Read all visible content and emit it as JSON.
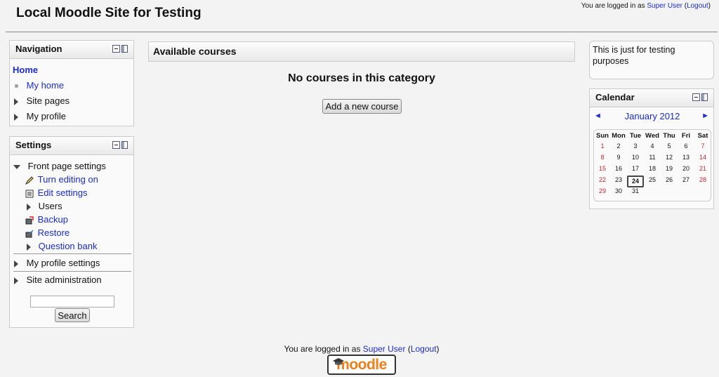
{
  "header": {
    "site_title": "Local Moodle Site for Testing",
    "login_prefix": "You are logged in as ",
    "user_name": "Super User",
    "logout_label": "Logout"
  },
  "navigation": {
    "title": "Navigation",
    "home": "Home",
    "items": [
      "My home",
      "Site pages",
      "My profile"
    ]
  },
  "settings": {
    "title": "Settings",
    "front_page": "Front page settings",
    "front_items": [
      "Turn editing on",
      "Edit settings",
      "Users",
      "Backup",
      "Restore",
      "Question bank"
    ],
    "my_profile_settings": "My profile settings",
    "site_administration": "Site administration",
    "search_button": "Search"
  },
  "main": {
    "heading": "Available courses",
    "empty_message": "No courses in this category",
    "add_course_button": "Add a new course"
  },
  "html_block": {
    "text": "This is just for testing purposes"
  },
  "calendar": {
    "title": "Calendar",
    "month": "January 2012",
    "prev": "◄",
    "next": "►",
    "days": [
      "Sun",
      "Mon",
      "Tue",
      "Wed",
      "Thu",
      "Fri",
      "Sat"
    ],
    "weeks": [
      [
        "1",
        "2",
        "3",
        "4",
        "5",
        "6",
        "7"
      ],
      [
        "8",
        "9",
        "10",
        "11",
        "12",
        "13",
        "14"
      ],
      [
        "15",
        "16",
        "17",
        "18",
        "19",
        "20",
        "21"
      ],
      [
        "22",
        "23",
        "24",
        "25",
        "26",
        "27",
        "28"
      ],
      [
        "29",
        "30",
        "31",
        "",
        "",
        "",
        ""
      ]
    ],
    "today": "24",
    "weekend_color": "#c1272d"
  },
  "footer": {
    "login_prefix": "You are logged in as ",
    "user_name": "Super User",
    "logout_label": "Logout",
    "logo_text": "moodle"
  },
  "colors": {
    "link": "#1a2bd8",
    "logo_orange": "#f07f1b"
  }
}
